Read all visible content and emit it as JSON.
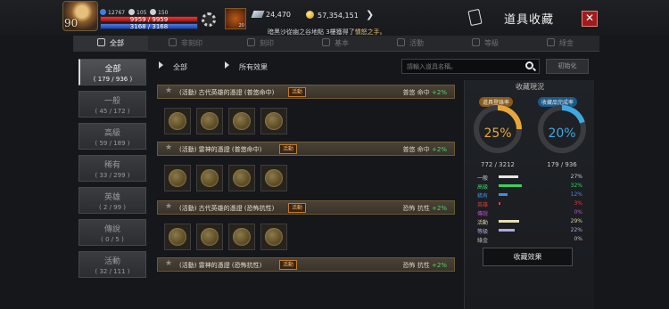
{
  "header": {
    "player_level": "90",
    "stat_a": "12767",
    "stat_b": "105",
    "stat_c": "150",
    "hp_text": "9959 / 9959",
    "hp_fraction": 1.0,
    "mp_text": "3168 / 3168",
    "mp_fraction": 1.0,
    "item_qty": "20",
    "currency_1": "24,470",
    "currency_2": "57,354,151",
    "window_title": "道具收藏",
    "close_label": "✕"
  },
  "notice": {
    "prefix": "暗黑沙從幽之谷地點 3樓獲得了",
    "highlight": "憤怒之手。"
  },
  "tabs": [
    {
      "label": "全部",
      "active": true
    },
    {
      "label": "非刻印"
    },
    {
      "label": "刻印"
    },
    {
      "label": "基本"
    },
    {
      "label": "活動"
    },
    {
      "label": "等級"
    },
    {
      "label": "綠金"
    }
  ],
  "sidebar": [
    {
      "label": "全部",
      "count": "( 179 / 936 )",
      "active": true
    },
    {
      "label": "一般",
      "count": "( 45 / 172 )"
    },
    {
      "label": "高級",
      "count": "( 59 / 189 )"
    },
    {
      "label": "稀有",
      "count": "( 33 / 299 )"
    },
    {
      "label": "英雄",
      "count": "( 2 / 99 )"
    },
    {
      "label": "傳說",
      "count": "( 0 / 5 )"
    },
    {
      "label": "活動",
      "count": "( 32 / 111 )"
    }
  ],
  "filters": {
    "category": "全部",
    "effect": "所有效果",
    "search_placeholder": "請輸入道具名稱。",
    "reset_label": "初始化"
  },
  "entries": [
    {
      "name": "(活動) 古代英雄的憑證 (普悠命中)",
      "badge": "活動",
      "effect_label": "普悠 命中",
      "effect_value": "+2%",
      "coins": 4
    },
    {
      "name": "(活動) 雷神的憑證 (普悠命中)",
      "badge": "活動",
      "effect_label": "普悠 命中",
      "effect_value": "+2%",
      "coins": 4
    },
    {
      "name": "(活動) 古代英雄的憑證 (恐怖抗性)",
      "badge": "活動",
      "effect_label": "恐怖 抗性",
      "effect_value": "+2%",
      "coins": 4
    },
    {
      "name": "(活動) 雷神的憑證 (恐怖抗性)",
      "badge": "活動",
      "effect_label": "恐怖 抗性",
      "effect_value": "+2%",
      "coins": 4
    }
  ],
  "status": {
    "title": "收藏現況",
    "ring1": {
      "label": "道具登錄率",
      "value": "25%",
      "fraction": 0.25,
      "count": "772 / 3212",
      "color": "#e8a63a"
    },
    "ring2": {
      "label": "收藏品完成率",
      "value": "20%",
      "fraction": 0.2,
      "count": "179 / 936",
      "color": "#3fa8e0"
    },
    "legend": [
      {
        "label": "一般",
        "value": "27%",
        "color": "#e6e6e6",
        "label_color": "#d0d0d0",
        "fraction": 0.27
      },
      {
        "label": "高級",
        "value": "32%",
        "color": "#3ad15a",
        "label_color": "#3ad15a",
        "fraction": 0.32
      },
      {
        "label": "稀有",
        "value": "12%",
        "color": "#3f8fe6",
        "label_color": "#3f8fe6",
        "fraction": 0.12
      },
      {
        "label": "英雄",
        "value": "3%",
        "color": "#e23b3b",
        "label_color": "#e23b3b",
        "fraction": 0.03
      },
      {
        "label": "傳說",
        "value": "0%",
        "color": "#c04fd0",
        "label_color": "#c04fd0",
        "fraction": 0.0
      },
      {
        "label": "活動",
        "value": "29%",
        "color": "#e8e0b0",
        "label_color": "#d8d0a0",
        "fraction": 0.29
      },
      {
        "label": "等級",
        "value": "22%",
        "color": "#b0a8e0",
        "label_color": "#b0a8e0",
        "fraction": 0.22
      },
      {
        "label": "綠金",
        "value": "0%",
        "color": "#9a9a9a",
        "label_color": "#bdbdbd",
        "fraction": 0.0
      }
    ],
    "effects_button": "收藏效果"
  }
}
